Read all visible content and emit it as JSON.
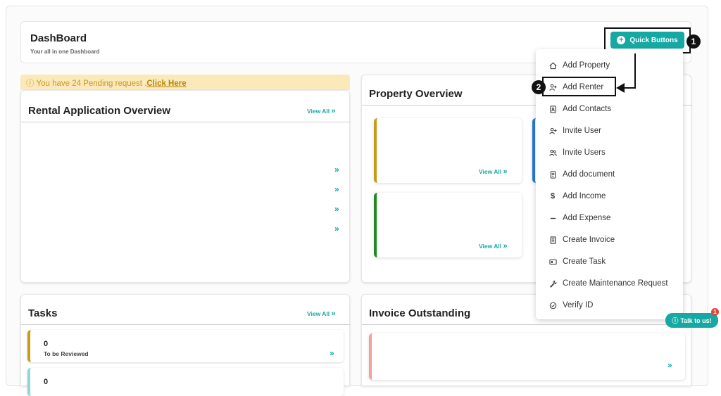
{
  "header": {
    "title": "DashBoard",
    "subtitle": "Your all in one Dashboard",
    "quick_buttons_label": "Quick Buttons"
  },
  "annotations": {
    "step1": "1",
    "step2": "2"
  },
  "pending": {
    "text": "You have 24 Pending request .",
    "link": "Click Here"
  },
  "rental_overview": {
    "title": "Rental Application Overview",
    "view_all": "View All"
  },
  "property_overview": {
    "title": "Property Overview",
    "view_all_1": "View All",
    "view_all_2": "View All"
  },
  "tasks": {
    "title": "Tasks",
    "view_all": "View All",
    "items": [
      {
        "count": "0",
        "label": "To be Reviewed"
      },
      {
        "count": "0",
        "label": ""
      }
    ]
  },
  "invoice_outstanding": {
    "title": "Invoice Outstanding"
  },
  "quick_menu": {
    "items": [
      {
        "label": "Add Property",
        "icon": "home-icon"
      },
      {
        "label": "Add Renter",
        "icon": "user-plus-icon"
      },
      {
        "label": "Add Contacts",
        "icon": "contact-book-icon"
      },
      {
        "label": "Invite User",
        "icon": "user-plus-icon"
      },
      {
        "label": "Invite Users",
        "icon": "users-icon"
      },
      {
        "label": "Add document",
        "icon": "document-icon"
      },
      {
        "label": "Add Income",
        "icon": "dollar-icon"
      },
      {
        "label": "Add Expense",
        "icon": "minus-icon"
      },
      {
        "label": "Create Invoice",
        "icon": "invoice-icon"
      },
      {
        "label": "Create Task",
        "icon": "task-icon"
      },
      {
        "label": "Create Maintenance Request",
        "icon": "wrench-icon"
      },
      {
        "label": "Verify ID",
        "icon": "check-circle-icon"
      }
    ]
  },
  "chat": {
    "label": "Talk to us!",
    "badge": "1"
  },
  "colors": {
    "accent": "#16a9a4",
    "pending_bg": "#fbe9bb",
    "gold_strip": "#c79a1a",
    "green_strip": "#1f8a1f",
    "blue_strip": "#2a78d6",
    "teal_strip": "#8fd6d6",
    "salmon_strip": "#f2a29a"
  }
}
